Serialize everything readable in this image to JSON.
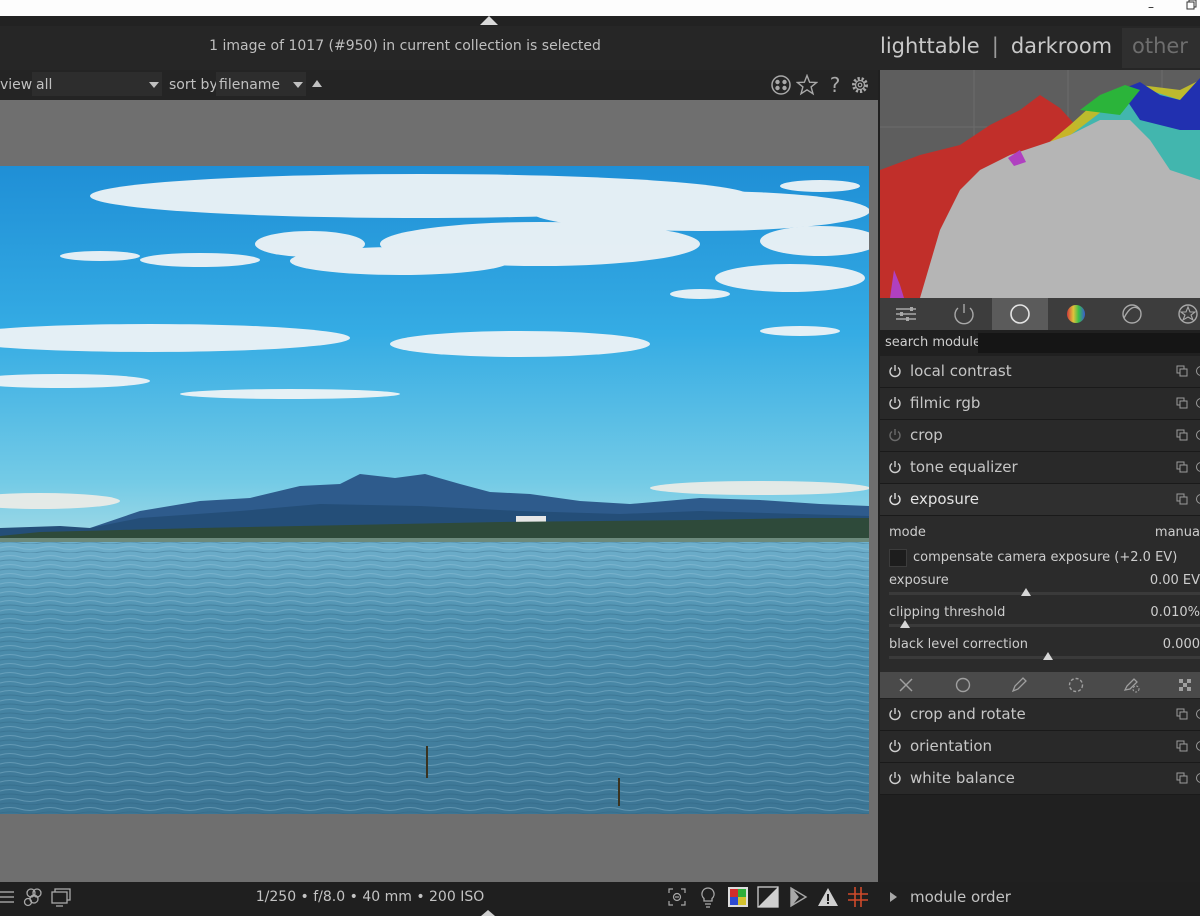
{
  "status_text": "1 image of 1017 (#950) in current collection is selected",
  "views": {
    "lighttable": "lighttable",
    "darkroom": "darkroom",
    "other": "other",
    "separator": "|"
  },
  "filter_bar": {
    "view_label": "view",
    "view_value": "all",
    "sort_label": "sort by",
    "sort_value": "filename"
  },
  "right_panel": {
    "search_label": "search module",
    "search_value": "",
    "modules_top": [
      {
        "label": "local contrast",
        "enabled": true
      },
      {
        "label": "filmic rgb",
        "enabled": true
      },
      {
        "label": "crop",
        "enabled": false
      },
      {
        "label": "tone equalizer",
        "enabled": true
      },
      {
        "label": "exposure",
        "enabled": true,
        "expanded": true
      }
    ],
    "exposure": {
      "mode_label": "mode",
      "mode_value": "manua",
      "compensate_label": "compensate camera exposure (+2.0 EV)",
      "compensate_checked": false,
      "sliders": [
        {
          "label": "exposure",
          "value": "0.00 EV",
          "level": 0.44
        },
        {
          "label": "clipping threshold",
          "value": "0.010%",
          "level": 0.05
        },
        {
          "label": "black level correction",
          "value": "0.000",
          "level": 0.51
        }
      ]
    },
    "modules_bottom": [
      {
        "label": "crop and rotate",
        "enabled": true
      },
      {
        "label": "orientation",
        "enabled": true
      },
      {
        "label": "white balance",
        "enabled": true
      }
    ]
  },
  "bottom_bar": {
    "exif": "1/250 • f/8.0 • 40 mm • 200 ISO",
    "module_order_label": "module order"
  },
  "icons": {
    "window": [
      "minimize-icon",
      "restore-icon"
    ],
    "filter_bar": [
      "color-labels-icon",
      "star-icon",
      "help-icon",
      "gear-icon"
    ],
    "module_groups": [
      "quick-access-icon",
      "active-modules-icon",
      "base-group-icon",
      "color-group-icon",
      "correct-group-icon",
      "effect-group-icon"
    ],
    "mask": [
      "mask-off-icon",
      "uniform-mask-icon",
      "drawn-mask-icon",
      "parametric-mask-icon",
      "drawn-parametric-mask-icon",
      "raster-mask-icon"
    ],
    "bottom_left": [
      "list-icon",
      "styles-icon",
      "display-icon"
    ],
    "bottom_right": [
      "focus-peaking-icon",
      "bulb-icon",
      "color-assessment-icon",
      "iso-icon",
      "softproof-icon",
      "gamut-warning-icon",
      "guides-icon"
    ]
  }
}
